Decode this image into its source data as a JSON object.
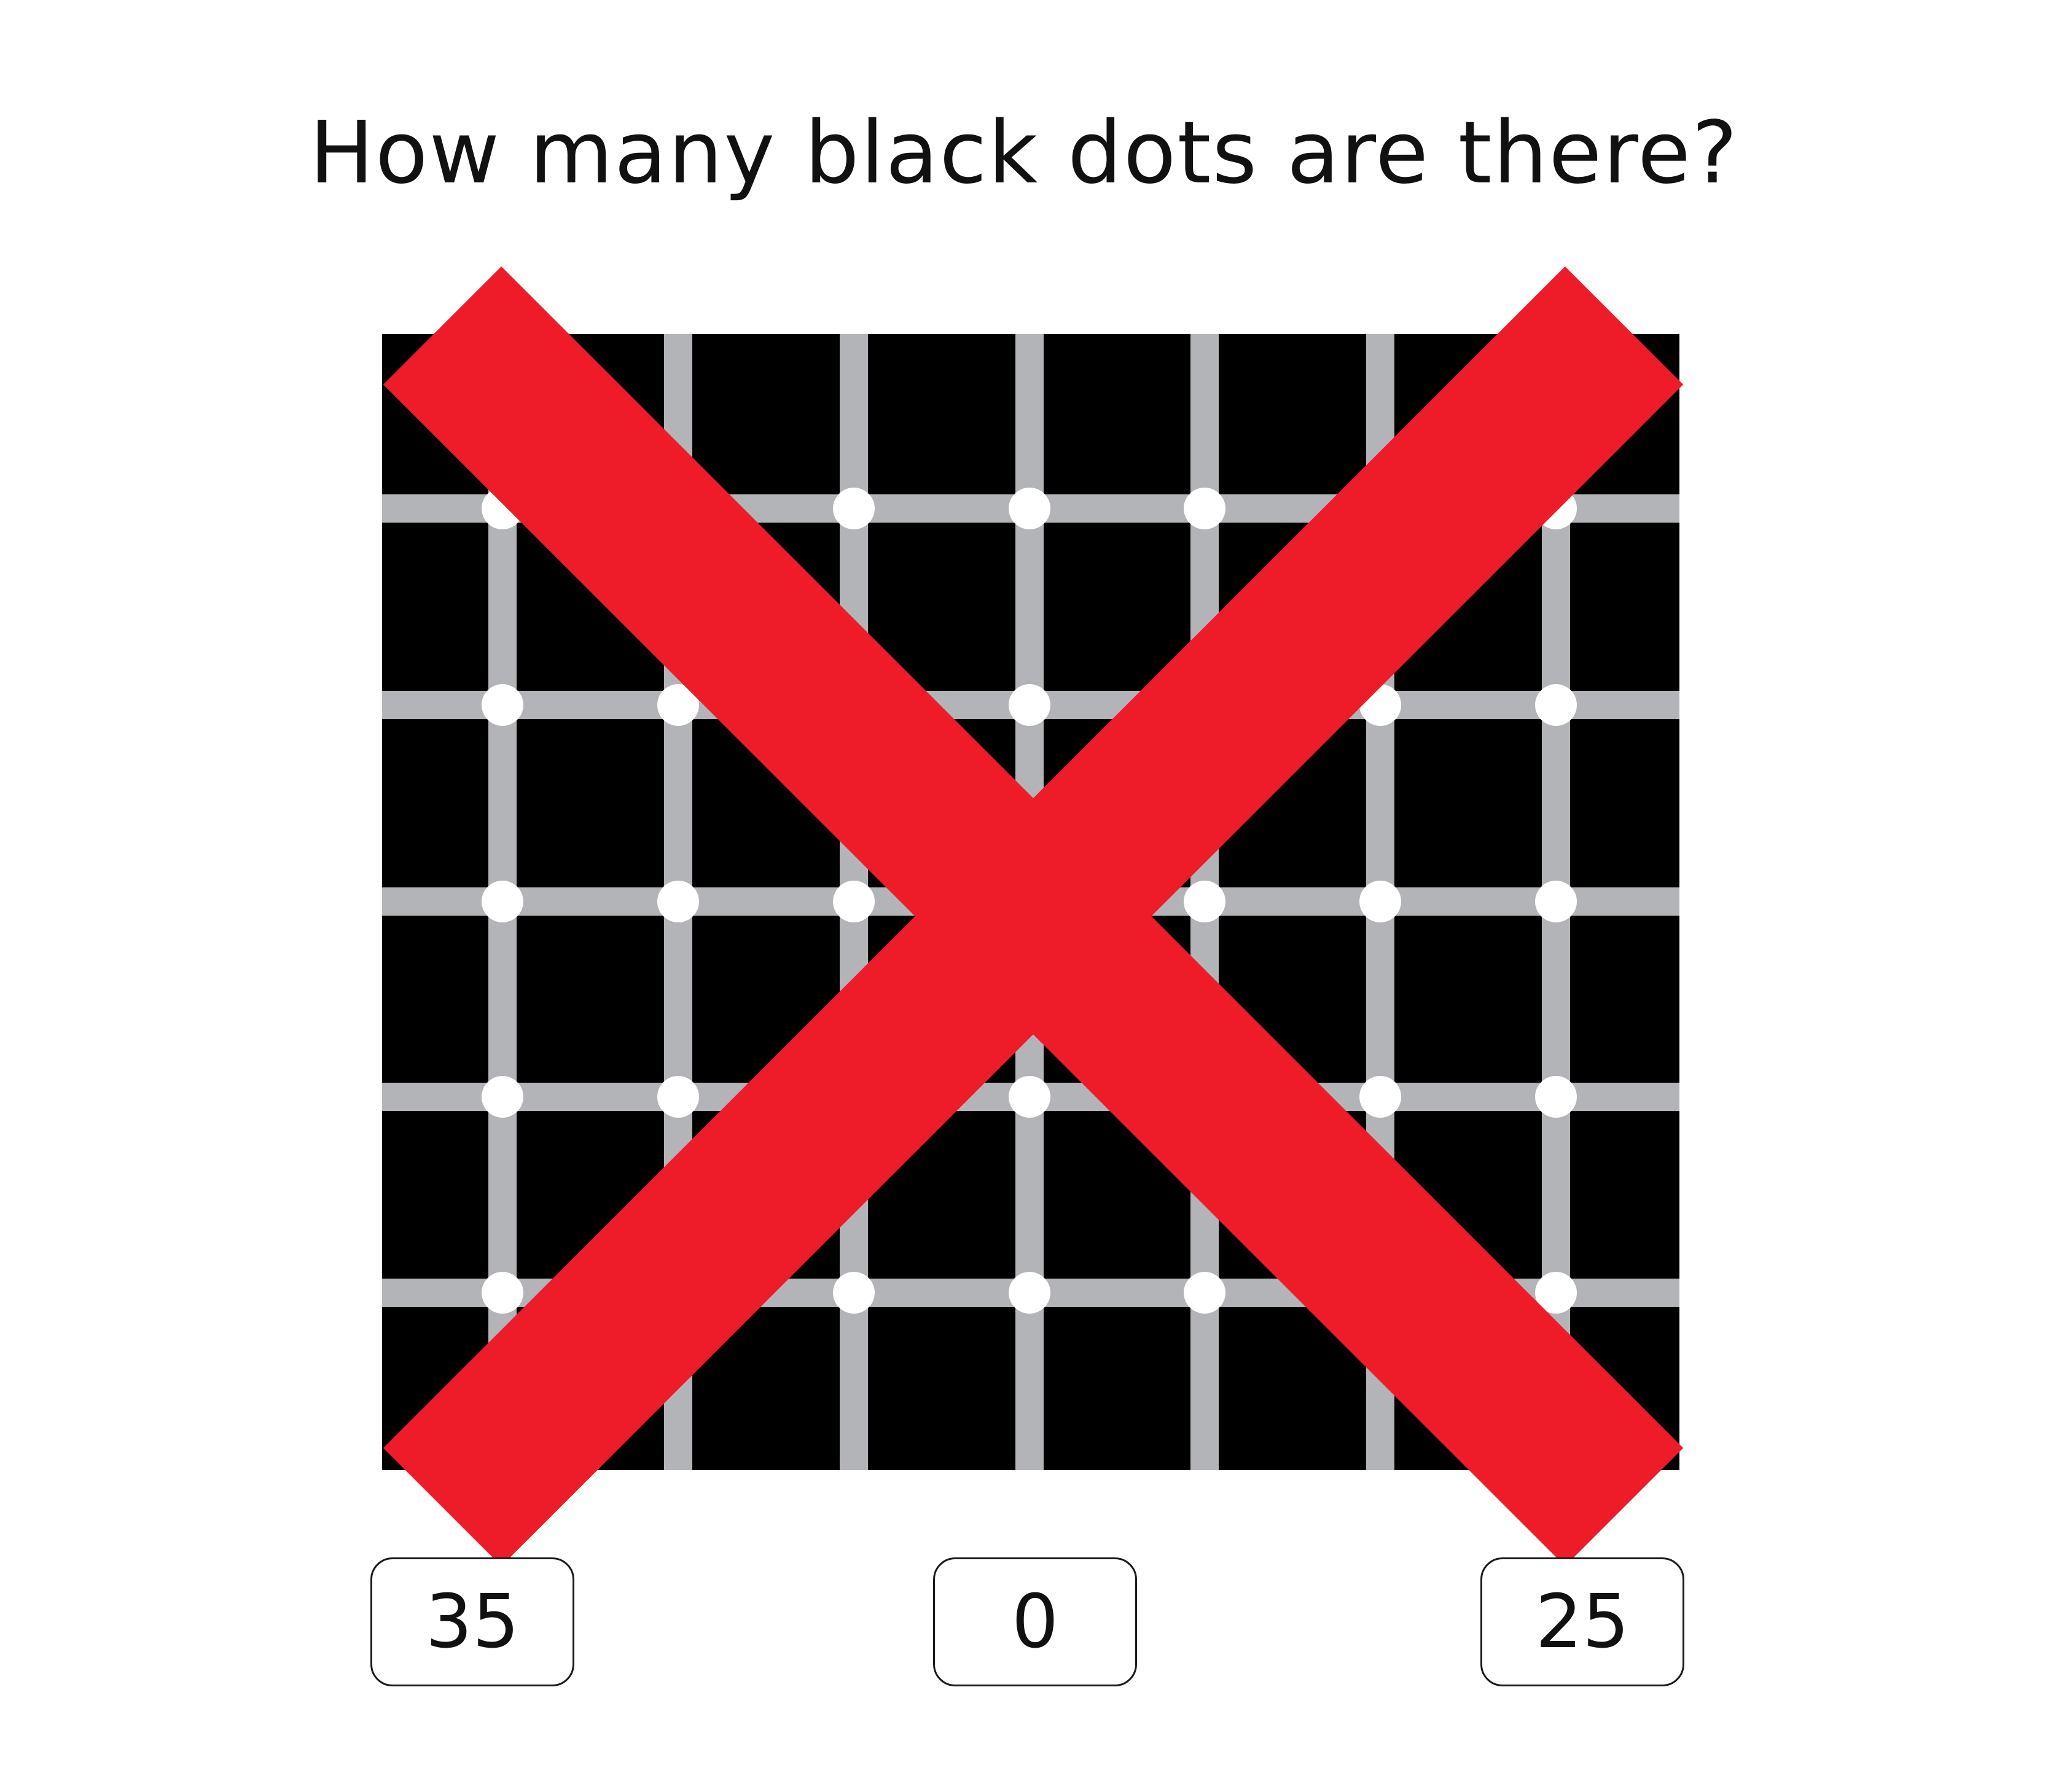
{
  "question": "How many black dots are there?",
  "answers": [
    "35",
    "0",
    "25"
  ],
  "colors": {
    "background": "#ffffff",
    "grid_background": "#000000",
    "grid_lines": "#b3b4b7",
    "dots": "#ffffff",
    "cross": "#ed1c28",
    "text": "#111111"
  }
}
